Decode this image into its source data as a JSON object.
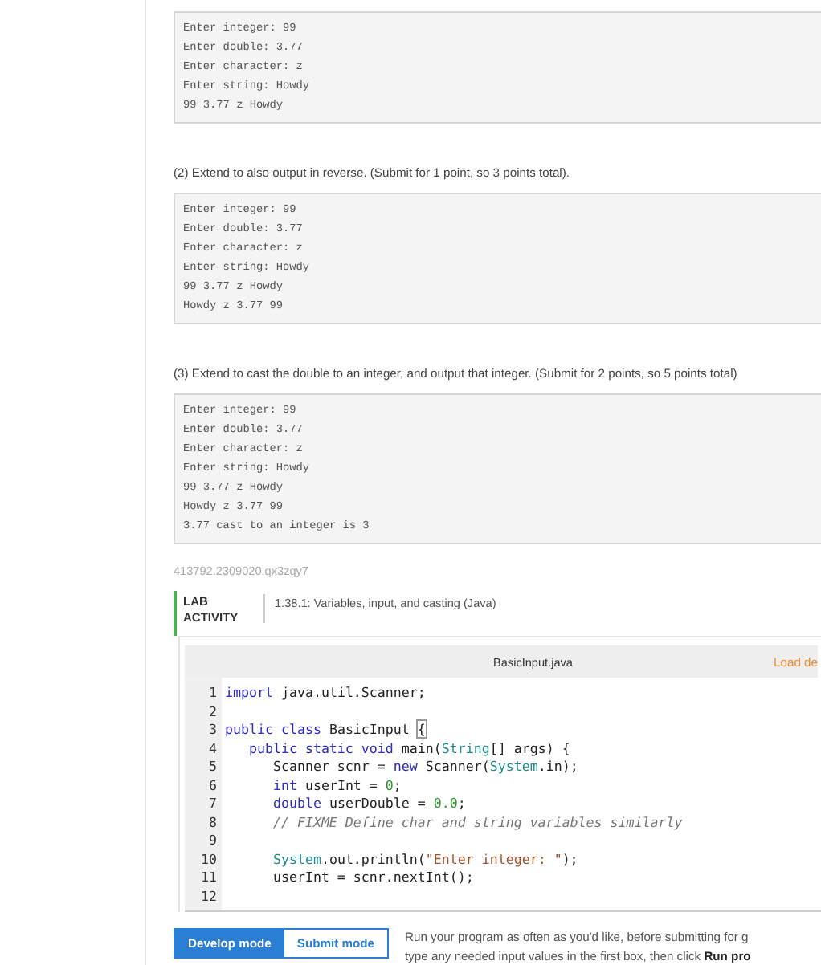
{
  "samples": [
    {
      "lines": [
        "Enter integer: 99",
        "Enter double: 3.77",
        "Enter character: z",
        "Enter string: Howdy",
        "99 3.77 z Howdy"
      ]
    },
    {
      "intro": "(2) Extend to also output in reverse. (Submit for 1 point, so 3 points total).",
      "lines": [
        "Enter integer: 99",
        "Enter double: 3.77",
        "Enter character: z",
        "Enter string: Howdy",
        "99 3.77 z Howdy",
        "Howdy z 3.77 99"
      ]
    },
    {
      "intro": "(3) Extend to cast the double to an integer, and output that integer. (Submit for 2 points, so 5 points total)",
      "lines": [
        "Enter integer: 99",
        "Enter double: 3.77",
        "Enter character: z",
        "Enter string: Howdy",
        "99 3.77 z Howdy",
        "Howdy z 3.77 99",
        "3.77 cast to an integer is 3"
      ]
    }
  ],
  "activity_id": "413792.2309020.qx3zqy7",
  "lab": {
    "label": "LAB ACTIVITY",
    "title": "1.38.1: Variables, input, and casting (Java)"
  },
  "editor": {
    "filename": "BasicInput.java",
    "load_link": "Load de",
    "lines": [
      {
        "number": "1",
        "tokens": [
          {
            "kind": "kw",
            "text": "import"
          },
          {
            "kind": "plain",
            "text": " java.util.Scanner;"
          }
        ]
      },
      {
        "number": "2"
      },
      {
        "number": "3",
        "tokens": [
          {
            "kind": "kw",
            "text": "public class"
          },
          {
            "kind": "plain",
            "text": " BasicInput "
          },
          {
            "kind": "match",
            "text": "{"
          }
        ]
      },
      {
        "number": "4",
        "tokens": [
          {
            "kind": "kw",
            "text": "   public static void"
          },
          {
            "kind": "plain",
            "text": " main("
          },
          {
            "kind": "type",
            "text": "String"
          },
          {
            "kind": "plain",
            "text": "[] args) {"
          }
        ]
      },
      {
        "number": "5",
        "tokens": [
          {
            "kind": "plain",
            "text": "      Scanner scnr = "
          },
          {
            "kind": "kw",
            "text": "new"
          },
          {
            "kind": "plain",
            "text": " Scanner("
          },
          {
            "kind": "type",
            "text": "System"
          },
          {
            "kind": "plain",
            "text": ".in);"
          }
        ]
      },
      {
        "number": "6",
        "tokens": [
          {
            "kind": "kw",
            "text": "      int"
          },
          {
            "kind": "plain",
            "text": " userInt = "
          },
          {
            "kind": "num",
            "text": "0"
          },
          {
            "kind": "plain",
            "text": ";"
          }
        ]
      },
      {
        "number": "7",
        "tokens": [
          {
            "kind": "kw",
            "text": "      double"
          },
          {
            "kind": "plain",
            "text": " userDouble = "
          },
          {
            "kind": "num",
            "text": "0.0"
          },
          {
            "kind": "plain",
            "text": ";"
          }
        ]
      },
      {
        "number": "8",
        "tokens": [
          {
            "kind": "comment",
            "text": "      // FIXME Define char and string variables similarly"
          }
        ]
      },
      {
        "number": "9"
      },
      {
        "number": "10",
        "tokens": [
          {
            "kind": "type",
            "text": "      System"
          },
          {
            "kind": "plain",
            "text": ".out.println("
          },
          {
            "kind": "str",
            "text": "\"Enter integer: \""
          },
          {
            "kind": "plain",
            "text": ");"
          }
        ]
      },
      {
        "number": "11",
        "tokens": [
          {
            "kind": "plain",
            "text": "      userInt = scnr.nextInt();"
          }
        ]
      },
      {
        "number": "12"
      }
    ]
  },
  "modes": [
    {
      "label": "Develop mode",
      "selected": true
    },
    {
      "label": "Submit mode",
      "selected": false
    }
  ],
  "instructions": [
    "Run your program as often as you'd like, before submitting for g",
    "type any needed input values in the first box, then click **Run pro**"
  ]
}
